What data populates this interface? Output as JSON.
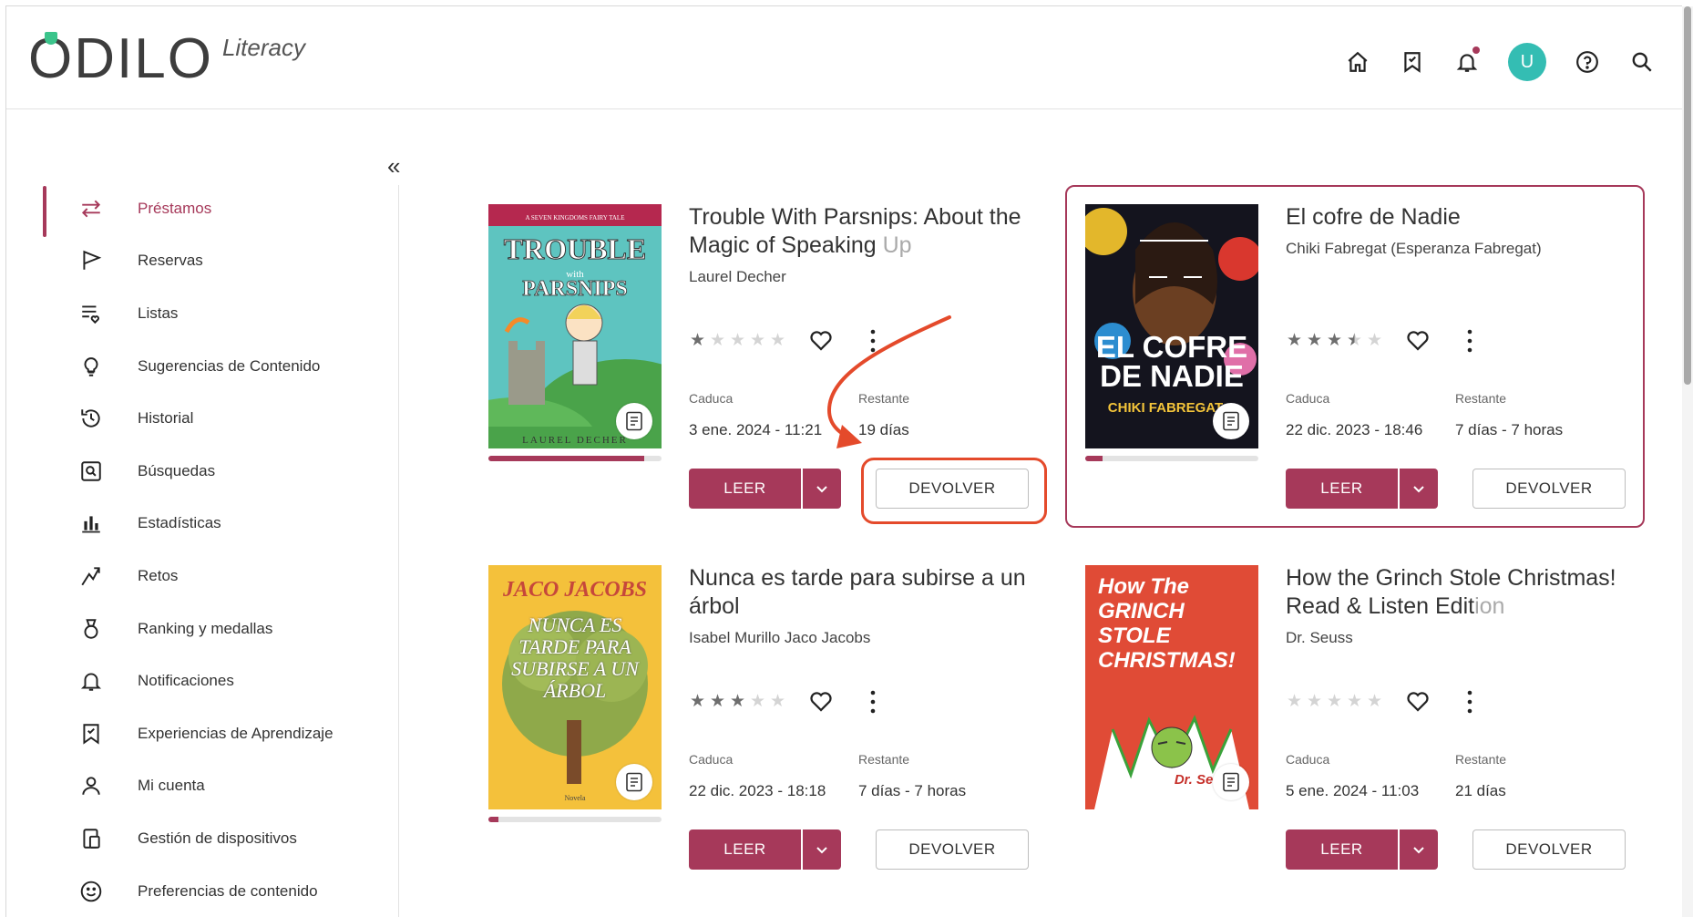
{
  "header": {
    "logo_text": "ODILO",
    "logo_sub": "Literacy",
    "avatar_initial": "U",
    "icons": [
      "home-icon",
      "bookmark-icon",
      "bell-icon",
      "avatar",
      "help-icon",
      "search-icon"
    ]
  },
  "sidebar": {
    "items": [
      {
        "label": "Préstamos",
        "icon": "swap-arrows-icon",
        "active": true
      },
      {
        "label": "Reservas",
        "icon": "flag-icon"
      },
      {
        "label": "Listas",
        "icon": "list-heart-icon"
      },
      {
        "label": "Sugerencias de Contenido",
        "icon": "lightbulb-icon"
      },
      {
        "label": "Historial",
        "icon": "history-icon"
      },
      {
        "label": "Búsquedas",
        "icon": "search-box-icon"
      },
      {
        "label": "Estadísticas",
        "icon": "bar-chart-icon"
      },
      {
        "label": "Retos",
        "icon": "challenge-icon"
      },
      {
        "label": "Ranking y medallas",
        "icon": "medal-icon"
      },
      {
        "label": "Notificaciones",
        "icon": "bell-icon"
      },
      {
        "label": "Experiencias de Aprendizaje",
        "icon": "learning-bookmark-icon"
      },
      {
        "label": "Mi cuenta",
        "icon": "user-icon"
      },
      {
        "label": "Gestión de dispositivos",
        "icon": "devices-icon"
      },
      {
        "label": "Preferencias de contenido",
        "icon": "smiley-icon"
      }
    ]
  },
  "labels": {
    "caduca": "Caduca",
    "restante": "Restante",
    "leer": "LEER",
    "devolver": "DEVOLVER"
  },
  "loans": [
    {
      "title_main": "Trouble With Parsnips: About the Magic of Speaking ",
      "title_fade": "Up",
      "author": "Laurel Decher",
      "rating": 1,
      "expires": "3 ene. 2024 - 11:21",
      "remaining": "19 días",
      "progress": 0.9,
      "cover": {
        "top": "A SEVEN KINGDOMS FAIRY TALE",
        "title1": "TROUBLE",
        "with": "with",
        "title2": "PARSNIPS",
        "author": "LAUREL DECHER"
      }
    },
    {
      "title_main": "El cofre de Nadie",
      "title_fade": "",
      "author": "Chiki Fabregat (Esperanza Fabregat)",
      "rating": 3.5,
      "expires": "22 dic. 2023 - 18:46",
      "remaining": "7 días - 7 horas",
      "progress": 0.1,
      "highlighted": true,
      "cover": {
        "title1": "EL COFRE",
        "title2": "DE NADIE",
        "author": "CHIKI FABREGAT"
      }
    },
    {
      "title_main": "Nunca es tarde para subirse a un árbol",
      "title_fade": "",
      "author": "Isabel Murillo Jaco Jacobs",
      "rating": 3,
      "expires": "22 dic. 2023 - 18:18",
      "remaining": "7 días - 7 horas",
      "progress": 0.06,
      "cover": {
        "author": "JACO JACOBS",
        "title": "NUNCA ES TARDE PARA SUBIRSE A UN ÁRBOL",
        "foot": "Novela"
      }
    },
    {
      "title_main": "How the Grinch Stole Christmas! Read & Listen Edit",
      "title_fade": "ion",
      "author": "Dr. Seuss",
      "rating": 0,
      "expires": "5 ene. 2024 - 11:03",
      "remaining": "21 días",
      "progress": 0,
      "cover": {
        "title": "How The GRINCH STOLE CHRISTMAS!",
        "author": "Dr. Seuss"
      }
    }
  ],
  "annotation": {
    "color": "#e44a2b",
    "target": "devolver-button"
  },
  "colors": {
    "accent": "#a6395a",
    "avatar": "#34bdb3",
    "logo_dot": "#3bc48b"
  }
}
